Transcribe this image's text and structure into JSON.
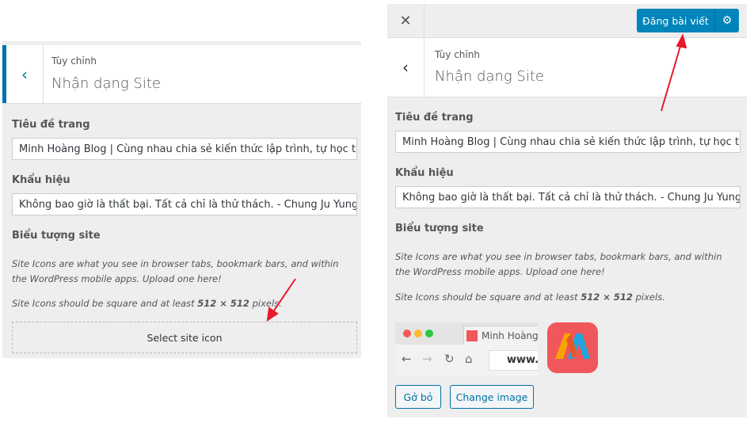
{
  "breadcrumb": "Tùy chỉnh",
  "section_title": "Nhận dạng Site",
  "site_title": {
    "label": "Tiêu đề trang",
    "value": "Minh Hoàng Blog | Cùng nhau chia sẻ kiến thức lập trình, tự học tiến"
  },
  "tagline": {
    "label": "Khẩu hiệu",
    "value": "Không bao giờ là thất bại. Tất cả chỉ là thử thách. - Chung Ju Yung"
  },
  "site_icon": {
    "label": "Biểu tượng site",
    "desc1": "Site Icons are what you see in browser tabs, bookmark bars, and within the WordPress mobile apps. Upload one here!",
    "desc2_pre": "Site Icons should be square and at least ",
    "desc2_bold": "512 × 512",
    "desc2_post": " pixels.",
    "select_label": "Select site icon",
    "remove_label": "Gở bỏ",
    "change_label": "Change image",
    "preview_tab_title": "Minh Hoàng",
    "preview_url": "www."
  },
  "publish_label": "Đăng bài viết",
  "colors": {
    "accent": "#0073aa",
    "arrow": "#e8192c",
    "icon_bg": "#f0575a"
  }
}
